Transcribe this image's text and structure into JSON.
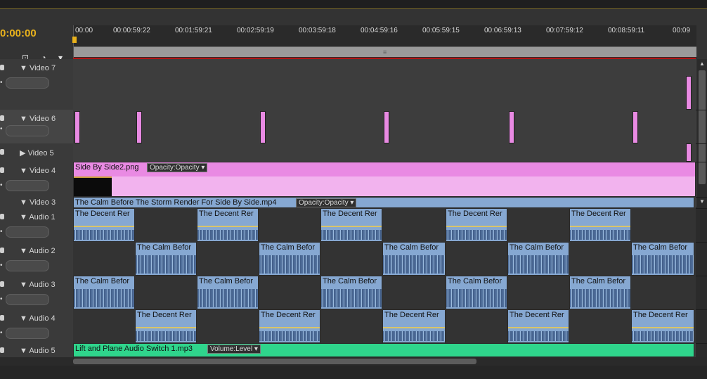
{
  "timecode": "0:00:00",
  "header_icons": [
    "snap-icon",
    "marker-icon",
    "pin-icon"
  ],
  "ruler_ticks": [
    "00:00",
    "00:00:59:22",
    "00:01:59:21",
    "00:02:59:19",
    "00:03:59:18",
    "00:04:59:16",
    "00:05:59:15",
    "00:06:59:13",
    "00:07:59:12",
    "00:08:59:11",
    "00:09"
  ],
  "tracks": {
    "video7": "Video 7",
    "video6": "Video 6",
    "video5": "Video 5",
    "video4": "Video 4",
    "video3": "Video 3",
    "audio1": "Audio 1",
    "audio2": "Audio 2",
    "audio3": "Audio 3",
    "audio4": "Audio 4",
    "audio5": "Audio 5"
  },
  "clips": {
    "video4_name": "Side By Side2.png",
    "video4_fx": "Opacity:Opacity",
    "video3_name": "The Calm Before The Storm Render For Side By Side.mp4",
    "video3_fx": "Opacity:Opacity",
    "decent": "The Decent Rer",
    "calm": "The Calm Befor",
    "audio5_name": "Lift and Plane Audio Switch 1.mp3",
    "audio5_fx": "Volume:Level"
  },
  "colors": {
    "playhead": "#e9b21c",
    "video_clip": "#e98ae3",
    "audio_clip": "#86a8d2",
    "audio5_clip": "#2fd58c"
  }
}
